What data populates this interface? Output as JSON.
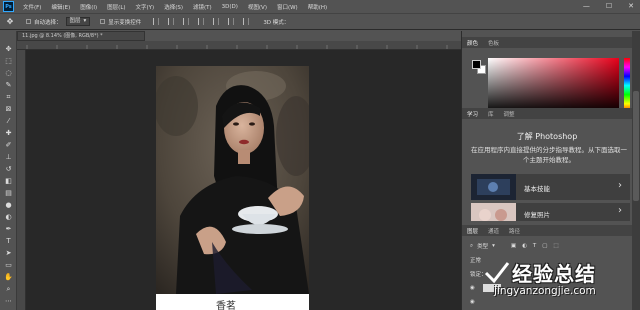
{
  "app": {
    "logo_text": "Ps"
  },
  "menubar": {
    "items": [
      "文件(F)",
      "编辑(E)",
      "图像(I)",
      "图层(L)",
      "文字(Y)",
      "选择(S)",
      "滤镜(T)",
      "3D(D)",
      "视图(V)",
      "窗口(W)",
      "帮助(H)"
    ],
    "window_controls": [
      "—",
      "☐",
      "✕"
    ]
  },
  "options_bar": {
    "auto_select_label": "自动选择：",
    "auto_select_value": "图层",
    "transform_label": "显示变换控件",
    "mode_3d_label": "3D 模式："
  },
  "document": {
    "tab_label": "11.jpg @ 8.14% (图像, RGB/8*) *",
    "signature_text": "香茗"
  },
  "color_panel": {
    "tabs": [
      "颜色",
      "色板"
    ],
    "foreground": "#000000",
    "background": "#ffffff",
    "hue_color": "#e8001a"
  },
  "learn_panel": {
    "tabs": [
      "学习",
      "库",
      "调整"
    ],
    "title": "了解 Photoshop",
    "description": "在应用程序内直接提供的分步指导教程。从下面选取一个主题开始教程。",
    "cards": [
      {
        "label": "基本技能"
      },
      {
        "label": "修复照片"
      }
    ]
  },
  "layers_panel": {
    "tabs": [
      "图层",
      "通道",
      "路径"
    ],
    "filter_label": "类型",
    "blend_mode": "正常",
    "lock_label": "锁定："
  },
  "watermark": {
    "cn": "经验总结",
    "en": "jingyanzongjie.com"
  }
}
